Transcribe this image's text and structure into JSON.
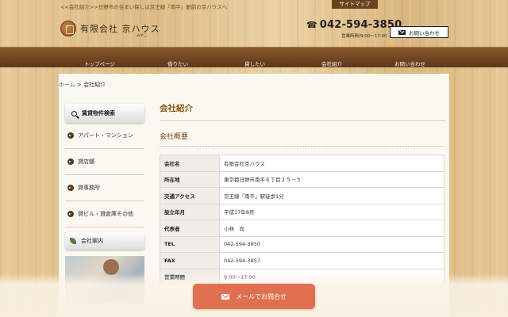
{
  "header": {
    "tagline": "<<会社紹介>>日野市の住まい探しは京王線「南平」駅前の京ハウスへ",
    "sitemap": "サイトマップ",
    "logo_text": "有限会社 京ハウス",
    "logo_sub": "みやこ",
    "phone": "042-594-3850",
    "hours": "営業時間/9:00〜17:00",
    "contact_button": "お問い合わせ",
    "icons": {
      "phone": "phone-icon",
      "mail": "mail-icon"
    }
  },
  "nav": {
    "items": [
      "トップページ",
      "借りたい",
      "貸したい",
      "会社紹介",
      "お問い合わせ"
    ]
  },
  "breadcrumb": {
    "home": "ホーム",
    "separator": ">",
    "current": "会社紹介"
  },
  "sidebar": {
    "search_heading": "賃貸物件検索",
    "items": [
      "アパート・マンション",
      "貸店舗",
      "貸事務所",
      "貸ビル・貸倉庫その他"
    ],
    "company_heading": "会社案内"
  },
  "content": {
    "title": "会社紹介",
    "subtitle": "会社概要",
    "rows": [
      {
        "label": "会社名",
        "value": "有限会社京ハウス"
      },
      {
        "label": "所在地",
        "value": "東京都日野市南平６丁目２５－５"
      },
      {
        "label": "交通アクセス",
        "value": "京王線「南平」駅徒歩1分"
      },
      {
        "label": "設立年月",
        "value": "平成17年8月"
      },
      {
        "label": "代表者",
        "value": "小林　尚"
      },
      {
        "label": "TEL",
        "value": "042-594-3850"
      },
      {
        "label": "FAX",
        "value": "042-594-3857"
      },
      {
        "label": "営業時間",
        "value": "9:00〜17:00"
      }
    ]
  },
  "floating_button": {
    "label": "メールでお問合せ"
  },
  "colors": {
    "nav": "#6e4420",
    "accent": "#8a5a1e",
    "button": "#e07050",
    "link": "#2a6ea8"
  }
}
